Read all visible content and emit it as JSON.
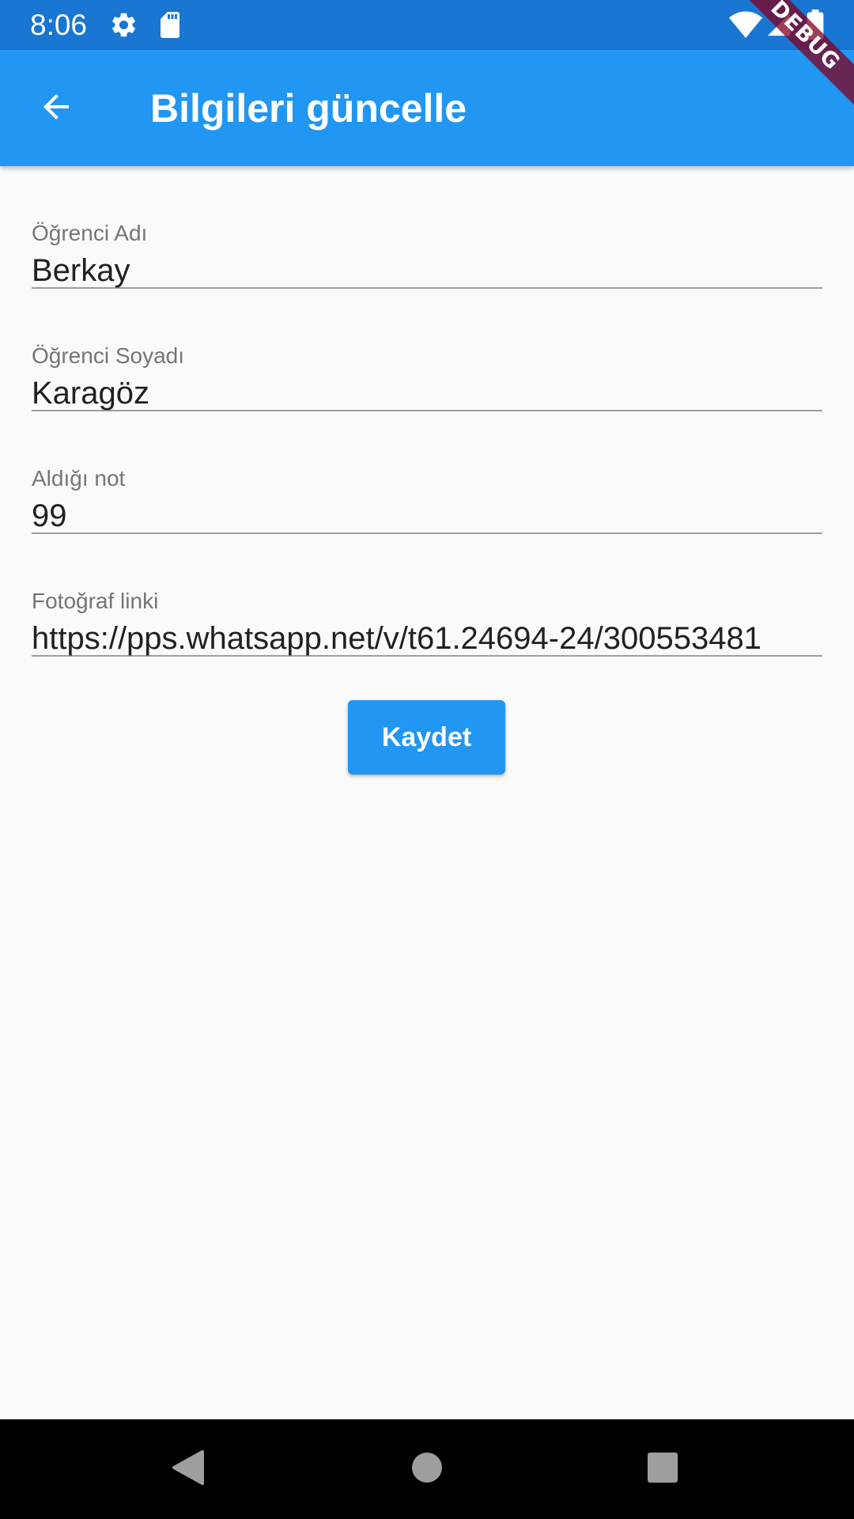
{
  "status_bar": {
    "time": "8:06",
    "icons": [
      "settings-icon",
      "sd-card-icon",
      "wifi-icon",
      "signal-icon",
      "battery-icon"
    ]
  },
  "debug_banner": "DEBUG",
  "app_bar": {
    "title": "Bilgileri güncelle",
    "back_icon": "arrow-back-icon",
    "color": "#2196f3"
  },
  "form": {
    "fields": [
      {
        "label": "Öğrenci Adı",
        "value": "Berkay"
      },
      {
        "label": "Öğrenci Soyadı",
        "value": "Karagöz"
      },
      {
        "label": "Aldığı not",
        "value": "99"
      },
      {
        "label": "Fotoğraf linki",
        "value": "https://pps.whatsapp.net/v/t61.24694-24/300553481"
      }
    ]
  },
  "save_button": {
    "label": "Kaydet",
    "color": "#2196f3"
  },
  "nav_bar": {
    "icons": [
      "nav-back-icon",
      "nav-home-icon",
      "nav-recents-icon"
    ]
  }
}
